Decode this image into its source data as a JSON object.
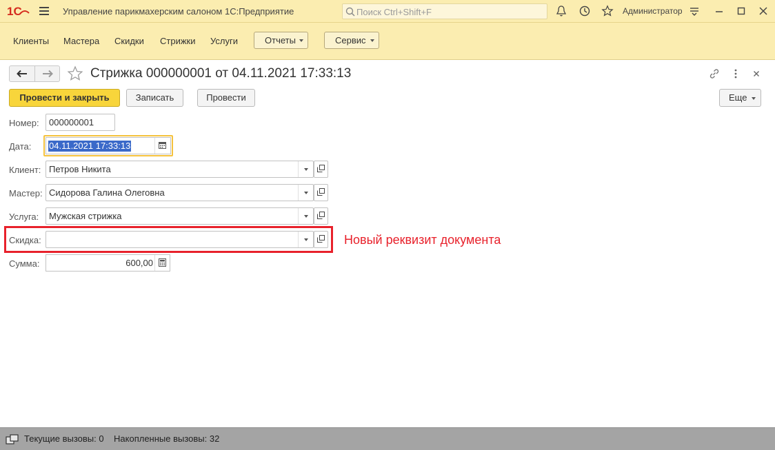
{
  "titlebar": {
    "logo_text": "1С",
    "app_title": "Управление парикмахерским салоном 1С:Предприятие",
    "search_placeholder": "Поиск Ctrl+Shift+F",
    "user": "Администратор"
  },
  "sections": {
    "items": [
      "Клиенты",
      "Мастера",
      "Скидки",
      "Стрижки",
      "Услуги"
    ],
    "menus": [
      "Отчеты",
      "Сервис"
    ]
  },
  "form": {
    "title": "Стрижка 000000001 от 04.11.2021 17:33:13",
    "buttons": {
      "post_close": "Провести и закрыть",
      "save": "Записать",
      "post": "Провести",
      "more": "Еще"
    },
    "fields": {
      "number": {
        "label": "Номер:",
        "value": "000000001"
      },
      "date": {
        "label": "Дата:",
        "value": "04.11.2021 17:33:13"
      },
      "client": {
        "label": "Клиент:",
        "value": "Петров Никита"
      },
      "master": {
        "label": "Мастер:",
        "value": "Сидорова Галина Олеговна"
      },
      "service": {
        "label": "Услуга:",
        "value": "Мужская стрижка"
      },
      "discount": {
        "label": "Скидка:",
        "value": ""
      },
      "sum": {
        "label": "Сумма:",
        "value": "600,00"
      }
    },
    "annotation": "Новый реквизит документа"
  },
  "statusbar": {
    "text": "Текущие вызовы: 0    Накопленные вызовы: 32"
  },
  "colors": {
    "header_bg": "#fbedb0",
    "primary_button": "#f8d53b",
    "focus_border": "#f5c23d",
    "annotation_red": "#e8212b",
    "selection": "#3a69c9",
    "statusbar_bg": "#a4a4a4"
  },
  "icons": [
    "logo-1c",
    "menu-icon",
    "search-icon",
    "bell-icon",
    "history-icon",
    "star-icon",
    "more-vertical-icon",
    "minimize-icon",
    "maximize-icon",
    "close-icon",
    "back-arrow-icon",
    "forward-arrow-icon",
    "link-icon",
    "calendar-icon",
    "calculator-icon",
    "open-icon",
    "dropdown-icon"
  ]
}
